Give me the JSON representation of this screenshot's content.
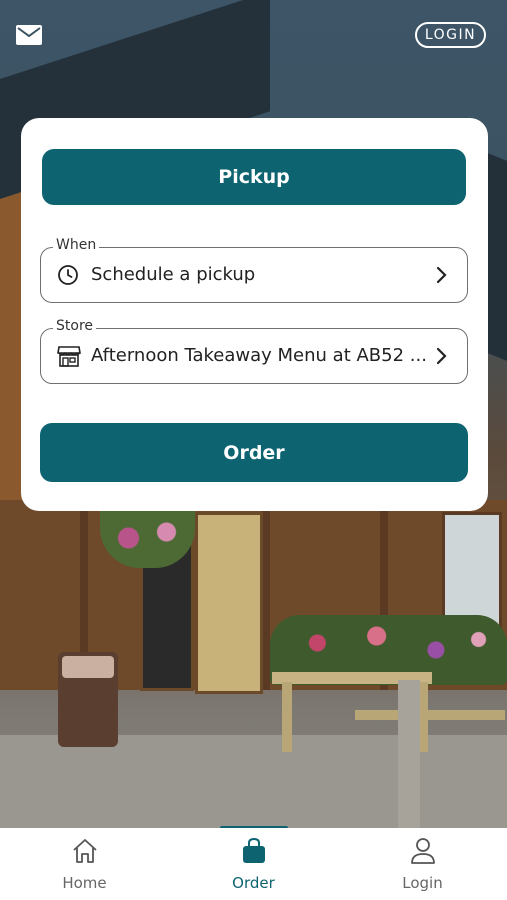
{
  "topbar": {
    "mail_icon": "mail-icon",
    "login_label": "LOGIN"
  },
  "card": {
    "mode_button_label": "Pickup",
    "when": {
      "label": "When",
      "value": "Schedule a pickup",
      "icon": "clock-icon"
    },
    "store": {
      "label": "Store",
      "value": "Afternoon Takeaway Menu at AB52 ...",
      "icon": "store-icon"
    },
    "order_button_label": "Order"
  },
  "bottom_nav": {
    "items": [
      {
        "label": "Home",
        "icon": "home-icon",
        "active": false
      },
      {
        "label": "Order",
        "icon": "shopping-bag-icon",
        "active": true
      },
      {
        "label": "Login",
        "icon": "user-icon",
        "active": false
      }
    ]
  },
  "colors": {
    "accent": "#0d6370",
    "card_bg": "#ffffff",
    "inactive_nav": "#666666"
  }
}
